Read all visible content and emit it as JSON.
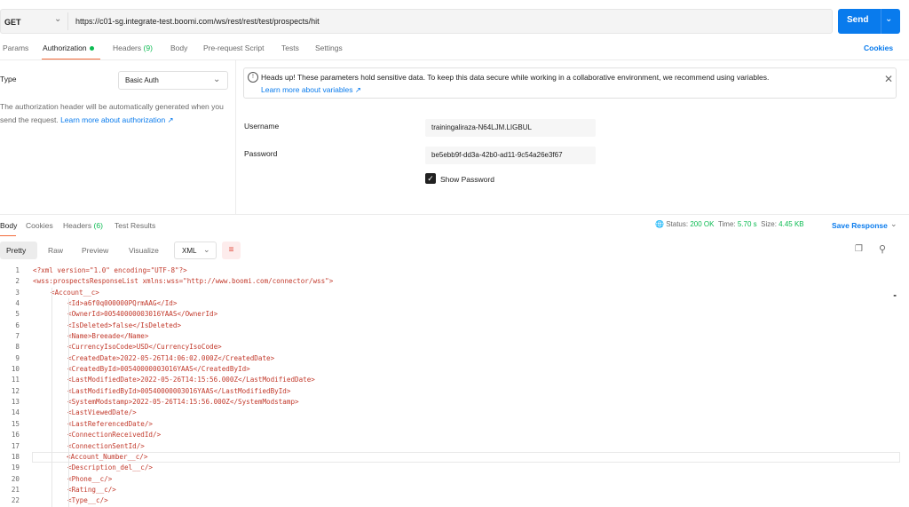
{
  "request": {
    "method": "GET",
    "url": "https://c01-sg.integrate-test.boomi.com/ws/rest/rest/test/prospects/hit",
    "send_label": "Send"
  },
  "tabs": {
    "params": "Params",
    "authorization": "Authorization",
    "headers": "Headers",
    "headers_count": "(9)",
    "body": "Body",
    "prerequest": "Pre-request Script",
    "tests": "Tests",
    "settings": "Settings",
    "cookies": "Cookies"
  },
  "auth": {
    "type_label": "Type",
    "type_value": "Basic Auth",
    "description": "The authorization header will be automatically generated when you send the request.",
    "learn_more": "Learn more about authorization ↗",
    "notice_text": "Heads up! These parameters hold sensitive data. To keep this data secure while working in a collaborative environment, we recommend using variables.",
    "notice_link": "Learn more about variables ↗",
    "username_label": "Username",
    "username_value": "trainingalirazа-N64LJM.LIGBUL",
    "password_label": "Password",
    "password_value": "be5ebb9f-dd3a-42b0-ad11-9c54a26e3f67",
    "show_password": "Show Password"
  },
  "response": {
    "tabs": {
      "body": "Body",
      "cookies": "Cookies",
      "headers": "Headers",
      "headers_count": "(6)",
      "test_results": "Test Results"
    },
    "status_label": "Status:",
    "status_value": "200 OK",
    "time_label": "Time:",
    "time_value": "5.70 s",
    "size_label": "Size:",
    "size_value": "4.45 KB",
    "save_label": "Save Response",
    "views": {
      "pretty": "Pretty",
      "raw": "Raw",
      "preview": "Preview",
      "visualize": "Visualize"
    },
    "format": "XML"
  },
  "code_lines": [
    {
      "n": "1",
      "indent": 0,
      "t": "<?xml version=\"1.0\" encoding=\"UTF-8\"?>"
    },
    {
      "n": "2",
      "indent": 0,
      "t": "<wss:prospectsResponseList xmlns:wss=\"http://www.boomi.com/connector/wss\">"
    },
    {
      "n": "3",
      "indent": 1,
      "t": "<Account__c>"
    },
    {
      "n": "4",
      "indent": 2,
      "t": "<Id>a6f0q000000PQrmAAG</Id>"
    },
    {
      "n": "5",
      "indent": 2,
      "t": "<OwnerId>00540000003016YAAS</OwnerId>"
    },
    {
      "n": "6",
      "indent": 2,
      "t": "<IsDeleted>false</IsDeleted>"
    },
    {
      "n": "7",
      "indent": 2,
      "t": "<Name>Breeade</Name>"
    },
    {
      "n": "8",
      "indent": 2,
      "t": "<CurrencyIsoCode>USD</CurrencyIsoCode>"
    },
    {
      "n": "9",
      "indent": 2,
      "t": "<CreatedDate>2022-05-26T14:06:02.000Z</CreatedDate>"
    },
    {
      "n": "10",
      "indent": 2,
      "t": "<CreatedById>00540000003016YAAS</CreatedById>"
    },
    {
      "n": "11",
      "indent": 2,
      "t": "<LastModifiedDate>2022-05-26T14:15:56.000Z</LastModifiedDate>"
    },
    {
      "n": "12",
      "indent": 2,
      "t": "<LastModifiedById>00540000003016YAAS</LastModifiedById>"
    },
    {
      "n": "13",
      "indent": 2,
      "t": "<SystemModstamp>2022-05-26T14:15:56.000Z</SystemModstamp>"
    },
    {
      "n": "14",
      "indent": 2,
      "t": "<LastViewedDate/>"
    },
    {
      "n": "15",
      "indent": 2,
      "t": "<LastReferencedDate/>"
    },
    {
      "n": "16",
      "indent": 2,
      "t": "<ConnectionReceivedId/>"
    },
    {
      "n": "17",
      "indent": 2,
      "t": "<ConnectionSentId/>"
    },
    {
      "n": "18",
      "indent": 2,
      "t": "<Account_Number__c/>"
    },
    {
      "n": "19",
      "indent": 2,
      "t": "<Description_del__c/>"
    },
    {
      "n": "20",
      "indent": 2,
      "t": "<Phone__c/>"
    },
    {
      "n": "21",
      "indent": 2,
      "t": "<Rating__c/>"
    },
    {
      "n": "22",
      "indent": 2,
      "t": "<Type__c/>"
    }
  ]
}
